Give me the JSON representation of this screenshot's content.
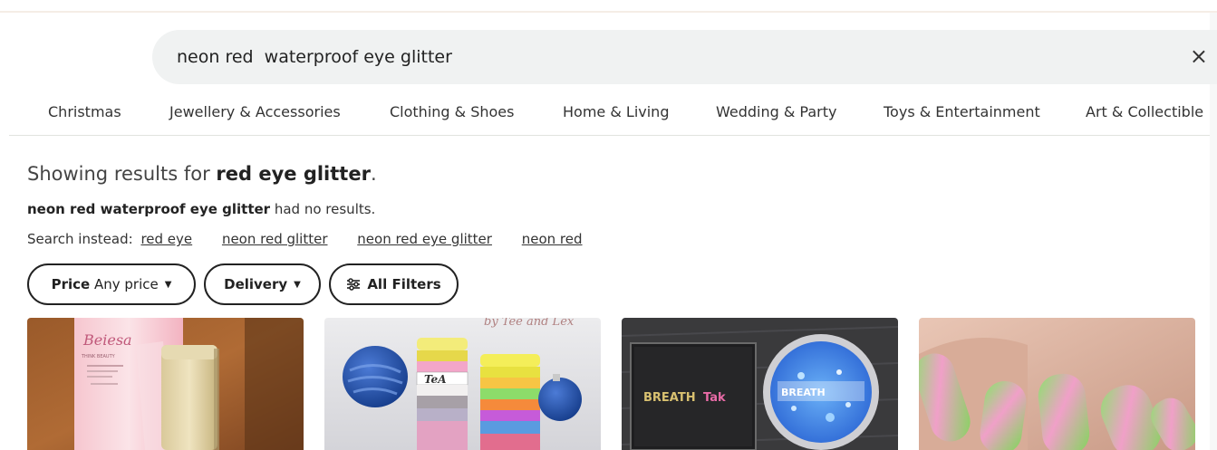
{
  "search": {
    "query": "neon red  waterproof eye glitter"
  },
  "categories": [
    "Christmas",
    "Jewellery & Accessories",
    "Clothing & Shoes",
    "Home & Living",
    "Wedding & Party",
    "Toys & Entertainment",
    "Art & Collectible"
  ],
  "results": {
    "showing_prefix": "Showing results for ",
    "showing_term": "red eye glitter",
    "showing_suffix": ".",
    "no_results_term": "neon red waterproof eye glitter",
    "no_results_suffix": " had no results.",
    "search_instead_label": "Search instead:",
    "suggestions": [
      "red eye",
      "neon red glitter",
      "neon red eye glitter",
      "neon red"
    ]
  },
  "filters": {
    "price_label": "Price",
    "price_value": "Any price",
    "delivery_label": "Delivery",
    "all_filters_label": "All Filters"
  },
  "products": [
    {
      "brand_text": "Beiesa",
      "subtitle": "THINK BEAUTY",
      "icon": "cosmetic-box-photo"
    },
    {
      "brand_text": "by Tee and Lex",
      "icon": "glitter-stack-photo"
    },
    {
      "brand_text": "BREATH",
      "icon": "glitter-palette-photo"
    },
    {
      "icon": "neon-nails-photo"
    }
  ],
  "colors": {
    "search_bg": "#f0f2f2",
    "text": "#222222",
    "pill_border": "#222222"
  }
}
